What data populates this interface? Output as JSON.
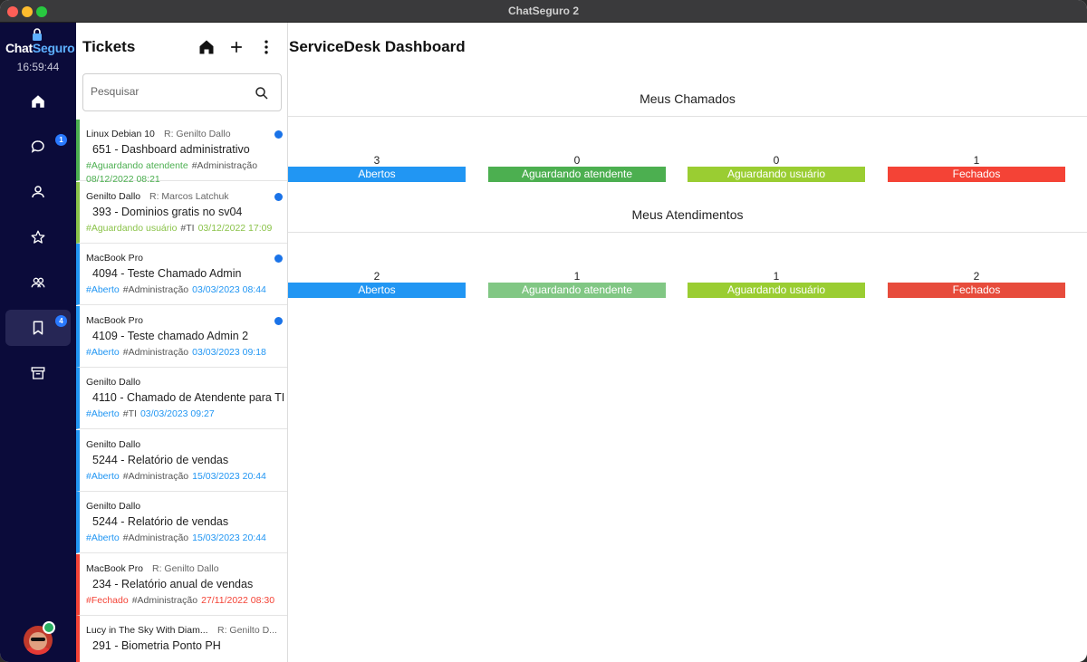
{
  "window": {
    "title": "ChatSeguro 2"
  },
  "sidebar": {
    "logo": {
      "part1": "Chat",
      "part2": "Seguro"
    },
    "clock": "16:59:44",
    "items": [
      {
        "name": "home",
        "icon": "home-icon",
        "badge": ""
      },
      {
        "name": "chats",
        "icon": "chat-bubble-icon",
        "badge": "1"
      },
      {
        "name": "contacts",
        "icon": "person-icon",
        "badge": ""
      },
      {
        "name": "favorites",
        "icon": "star-icon",
        "badge": ""
      },
      {
        "name": "groups",
        "icon": "group-icon",
        "badge": ""
      },
      {
        "name": "tickets",
        "icon": "bookmark-icon",
        "badge": "4",
        "active": true
      },
      {
        "name": "archive",
        "icon": "archive-icon",
        "badge": ""
      }
    ],
    "status_color": "#27ae60"
  },
  "tickets_panel": {
    "title": "Tickets",
    "search_placeholder": "Pesquisar",
    "tickets": [
      {
        "author": "Linux Debian 10",
        "responsible": "R: Genilto Dallo",
        "subject": "651 - Dashboard administrativo",
        "status_tag": "#Aguardando atendente",
        "dept_tag": "#Administração",
        "date": "08/12/2022 08:21",
        "color": "#4caf50",
        "unread": true,
        "date_on_new_line": true
      },
      {
        "author": "Genilto Dallo",
        "responsible": "R: Marcos Latchuk",
        "subject": "393 - Dominios gratis no sv04",
        "status_tag": "#Aguardando usuário",
        "dept_tag": "#TI",
        "date": "03/12/2022 17:09",
        "color": "#8bc34a",
        "unread": true,
        "date_on_new_line": false
      },
      {
        "author": "MacBook Pro",
        "responsible": "",
        "subject": "4094 - Teste Chamado Admin",
        "status_tag": "#Aberto",
        "dept_tag": "#Administração",
        "date": "03/03/2023 08:44",
        "color": "#2196f3",
        "unread": true,
        "date_on_new_line": false
      },
      {
        "author": "MacBook Pro",
        "responsible": "",
        "subject": "4109 - Teste chamado Admin 2",
        "status_tag": "#Aberto",
        "dept_tag": "#Administração",
        "date": "03/03/2023 09:18",
        "color": "#2196f3",
        "unread": true,
        "date_on_new_line": false
      },
      {
        "author": "Genilto Dallo",
        "responsible": "",
        "subject": "4110 - Chamado de Atendente para TI",
        "status_tag": "#Aberto",
        "dept_tag": "#TI",
        "date": "03/03/2023 09:27",
        "color": "#2196f3",
        "unread": false,
        "date_on_new_line": false
      },
      {
        "author": "Genilto Dallo",
        "responsible": "",
        "subject": "5244 - Relatório de vendas",
        "status_tag": "#Aberto",
        "dept_tag": "#Administração",
        "date": "15/03/2023 20:44",
        "color": "#2196f3",
        "unread": false,
        "date_on_new_line": false
      },
      {
        "author": "Genilto Dallo",
        "responsible": "",
        "subject": "5244 - Relatório de vendas",
        "status_tag": "#Aberto",
        "dept_tag": "#Administração",
        "date": "15/03/2023 20:44",
        "color": "#2196f3",
        "unread": false,
        "date_on_new_line": false
      },
      {
        "author": "MacBook Pro",
        "responsible": "R: Genilto Dallo",
        "subject": "234 - Relatório anual de vendas",
        "status_tag": "#Fechado",
        "dept_tag": "#Administração",
        "date": "27/11/2022 08:30",
        "color": "#f44336",
        "unread": false,
        "date_on_new_line": false
      },
      {
        "author": "Lucy in The Sky With Diam...",
        "responsible": "R: Genilto D...",
        "subject": "291 - Biometria Ponto PH",
        "status_tag": "",
        "dept_tag": "",
        "date": "",
        "color": "#f44336",
        "unread": false,
        "date_on_new_line": false
      }
    ]
  },
  "dashboard": {
    "title": "ServiceDesk Dashboard",
    "sections": [
      {
        "title": "Meus Chamados",
        "stats": [
          {
            "label": "Abertos",
            "count": "3",
            "color": "#2196f3"
          },
          {
            "label": "Aguardando atendente",
            "count": "0",
            "color": "#4caf50"
          },
          {
            "label": "Aguardando usuário",
            "count": "0",
            "color": "#9acd32"
          },
          {
            "label": "Fechados",
            "count": "1",
            "color": "#f44336"
          }
        ]
      },
      {
        "title": "Meus Atendimentos",
        "stats": [
          {
            "label": "Abertos",
            "count": "2",
            "color": "#2196f3"
          },
          {
            "label": "Aguardando atendente",
            "count": "1",
            "color": "#81c784"
          },
          {
            "label": "Aguardando usuário",
            "count": "1",
            "color": "#9acd32"
          },
          {
            "label": "Fechados",
            "count": "2",
            "color": "#e74c3c"
          }
        ]
      }
    ]
  }
}
